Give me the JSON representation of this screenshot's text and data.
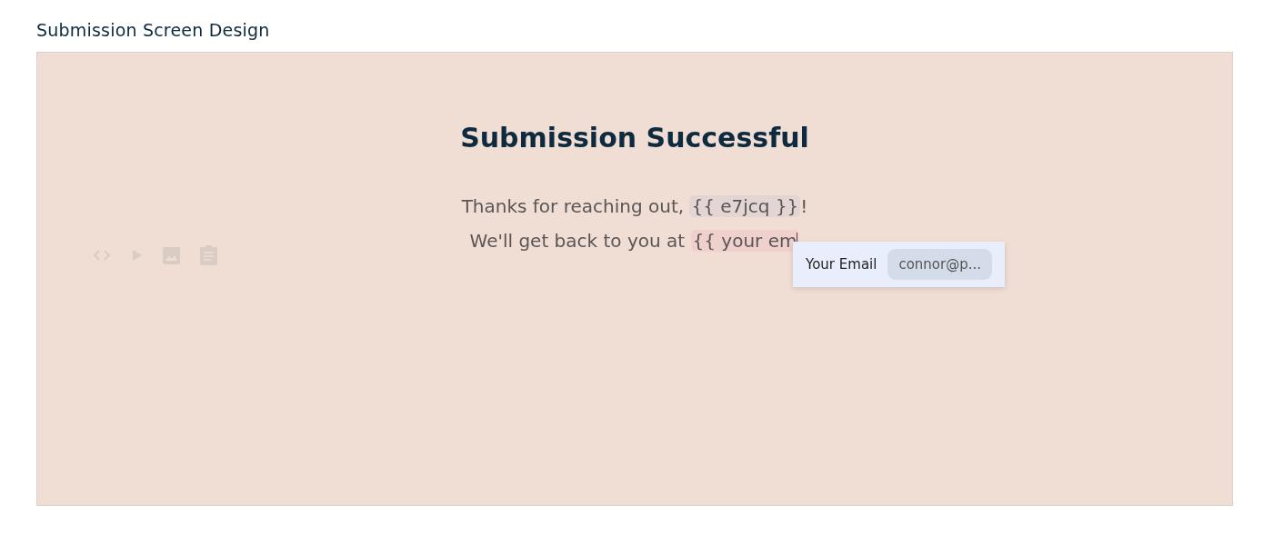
{
  "page_title": "Submission Screen Design",
  "screen": {
    "title": "Submission Successful",
    "lines": [
      {
        "text": "Thanks for reaching out, ",
        "token": {
          "text": "{{ e7jcq }}",
          "active": false
        },
        "after": "!"
      },
      {
        "text": "We'll get back to you at ",
        "token": {
          "text": "{{ your em",
          "active": true
        }
      }
    ]
  },
  "toolbar": {
    "disabled": true
  },
  "suggestion": {
    "label": "Your Email",
    "value": "connor@p..."
  }
}
